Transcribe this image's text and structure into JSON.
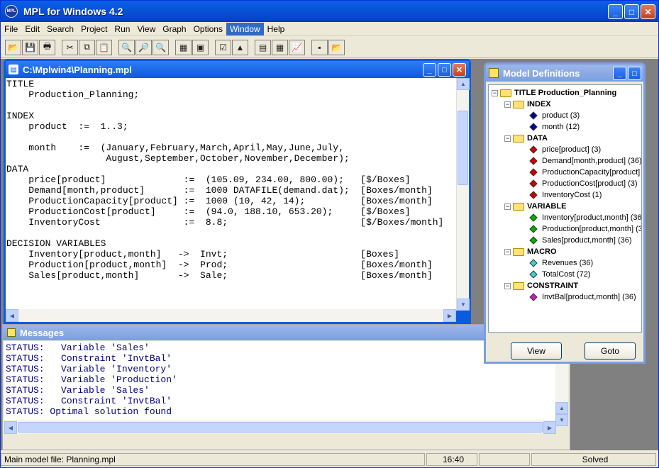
{
  "app": {
    "title": "MPL for Windows 4.2",
    "icon_text": "MPL"
  },
  "window_buttons": {
    "minimize": "_",
    "maximize": "□",
    "close": "✕"
  },
  "menu": [
    "File",
    "Edit",
    "Search",
    "Project",
    "Run",
    "View",
    "Graph",
    "Options",
    "Window",
    "Help"
  ],
  "menu_active": "Window",
  "toolbar": {
    "buttons": [
      {
        "name": "open-icon",
        "glyph": "📂"
      },
      {
        "name": "save-icon",
        "glyph": "💾"
      },
      {
        "name": "print-icon",
        "glyph": "🖶"
      },
      {
        "name": "cut-icon",
        "glyph": "✂"
      },
      {
        "name": "copy-icon",
        "glyph": "⧉"
      },
      {
        "name": "paste-icon",
        "glyph": "📋"
      },
      {
        "name": "find-icon",
        "glyph": "🔍"
      },
      {
        "name": "find-next-icon",
        "glyph": "🔎"
      },
      {
        "name": "replace-icon",
        "glyph": "🔍"
      },
      {
        "name": "parse-icon",
        "glyph": "▦"
      },
      {
        "name": "run-icon",
        "glyph": "▣"
      },
      {
        "name": "check-icon",
        "glyph": "☑"
      },
      {
        "name": "solve-icon",
        "glyph": "▲"
      },
      {
        "name": "view-solution-icon",
        "glyph": "▤"
      },
      {
        "name": "matrix-icon",
        "glyph": "▦"
      },
      {
        "name": "graph-icon",
        "glyph": "📈"
      },
      {
        "name": "messages-icon",
        "glyph": "▪"
      },
      {
        "name": "model-definitions-icon",
        "glyph": "📂"
      }
    ]
  },
  "editor": {
    "title": "C:\\Mplwin4\\Planning.mpl",
    "code": "TITLE\n    Production_Planning;\n\nINDEX\n    product  :=  1..3;\n\n    month    :=  (January,February,March,April,May,June,July,\n                  August,September,October,November,December);\nDATA\n    price[product]              :=  (105.09, 234.00, 800.00);   [$/Boxes]\n    Demand[month,product]       :=  1000 DATAFILE(demand.dat);  [Boxes/month]\n    ProductionCapacity[product] :=  1000 (10, 42, 14);          [Boxes/month]\n    ProductionCost[product]     :=  (94.0, 188.10, 653.20);     [$/Boxes]\n    InventoryCost               :=  8.8;                        [$/Boxes/month]\n\nDECISION VARIABLES\n    Inventory[product,month]   ->  Invt;                        [Boxes]\n    Production[product,month]  ->  Prod;                        [Boxes/month]\n    Sales[product,month]       ->  Sale;                        [Boxes/month]"
  },
  "messages": {
    "title": "Messages",
    "text": "STATUS:   Variable 'Sales'\nSTATUS:   Constraint 'InvtBal'\nSTATUS:   Variable 'Inventory'\nSTATUS:   Variable 'Production'\nSTATUS:   Variable 'Sales'\nSTATUS:   Constraint 'InvtBal'\nSTATUS: Optimal solution found"
  },
  "model_definitions": {
    "title": "Model Definitions",
    "root": "TITLE Production_Planning",
    "groups": [
      {
        "label": "INDEX",
        "items": [
          {
            "label": "product   (3)",
            "color": "#0000a0"
          },
          {
            "label": "month   (12)",
            "color": "#0000a0"
          }
        ]
      },
      {
        "label": "DATA",
        "items": [
          {
            "label": "price[product]   (3)",
            "color": "#d00000"
          },
          {
            "label": "Demand[month,product]   (36)",
            "color": "#d00000"
          },
          {
            "label": "ProductionCapacity[product]",
            "color": "#d00000"
          },
          {
            "label": "ProductionCost[product]   (3)",
            "color": "#d00000"
          },
          {
            "label": "InventoryCost   (1)",
            "color": "#d00000"
          }
        ]
      },
      {
        "label": "VARIABLE",
        "items": [
          {
            "label": "Inventory[product,month]   (36",
            "color": "#00b000"
          },
          {
            "label": "Production[product,month]   (3",
            "color": "#00b000"
          },
          {
            "label": "Sales[product,month]   (36)",
            "color": "#00b000"
          }
        ]
      },
      {
        "label": "MACRO",
        "items": [
          {
            "label": "Revenues   (36)",
            "color": "#40d0d0"
          },
          {
            "label": "TotalCost   (72)",
            "color": "#40d0d0"
          }
        ]
      },
      {
        "label": "CONSTRAINT",
        "items": [
          {
            "label": "InvtBal[product,month]   (36)",
            "color": "#c020c0"
          }
        ]
      }
    ],
    "view_label": "View",
    "goto_label": "Goto"
  },
  "status": {
    "file": "Main model file: Planning.mpl",
    "time": "16:40",
    "empty": "",
    "state": "Solved"
  }
}
